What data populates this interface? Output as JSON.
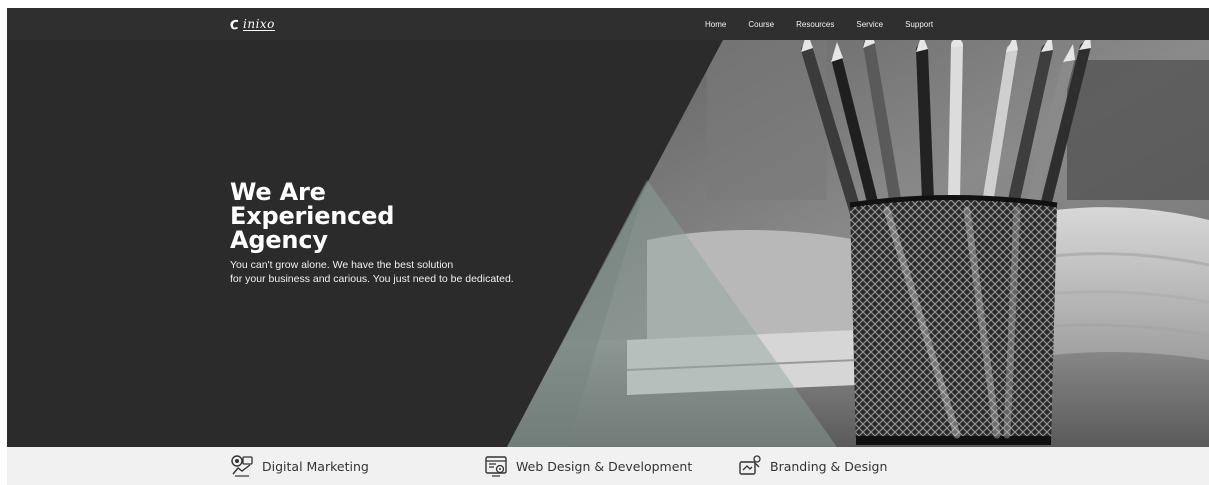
{
  "brand": {
    "logo_text": "inixo"
  },
  "nav": {
    "items": [
      {
        "label": "Home"
      },
      {
        "label": "Course"
      },
      {
        "label": "Resources"
      },
      {
        "label": "Service"
      },
      {
        "label": "Support"
      }
    ]
  },
  "hero": {
    "title_lines": [
      "We Are",
      "Experienced",
      "Agency"
    ],
    "description_lines": [
      "You can't grow alone. We have the best solution",
      "for your business and carious. You just need to be dedicated."
    ]
  },
  "services": [
    {
      "label": "Digital Marketing",
      "icon": "digital-marketing-icon"
    },
    {
      "label": "Web Design & Development",
      "icon": "web-design-icon"
    },
    {
      "label": "Branding & Design",
      "icon": "branding-design-icon"
    }
  ]
}
